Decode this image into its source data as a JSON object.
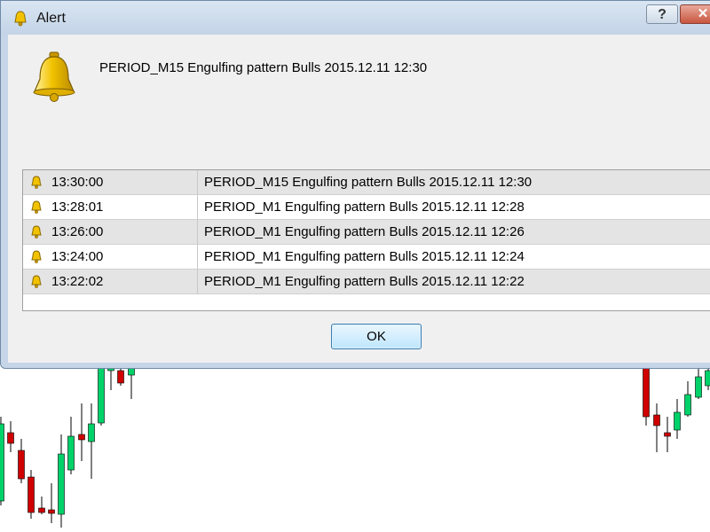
{
  "window": {
    "title": "Alert",
    "help_label": "?",
    "close_label": "✕"
  },
  "alert": {
    "message": "PERIOD_M15 Engulfing pattern Bulls 2015.12.11 12:30",
    "icon": "bell-icon"
  },
  "history": [
    {
      "time": "13:30:00",
      "message": "PERIOD_M15 Engulfing pattern Bulls 2015.12.11 12:30"
    },
    {
      "time": "13:28:01",
      "message": "PERIOD_M1 Engulfing pattern Bulls 2015.12.11 12:28"
    },
    {
      "time": "13:26:00",
      "message": "PERIOD_M1 Engulfing pattern Bulls 2015.12.11 12:26"
    },
    {
      "time": "13:24:00",
      "message": "PERIOD_M1 Engulfing pattern Bulls 2015.12.11 12:24"
    },
    {
      "time": "13:22:02",
      "message": "PERIOD_M1 Engulfing pattern Bulls 2015.12.11 12:22"
    }
  ],
  "buttons": {
    "ok_label": "OK"
  },
  "colors": {
    "bull_candle": "#00d26a",
    "bear_candle": "#d00000",
    "bell_gold": "#e8b800"
  }
}
